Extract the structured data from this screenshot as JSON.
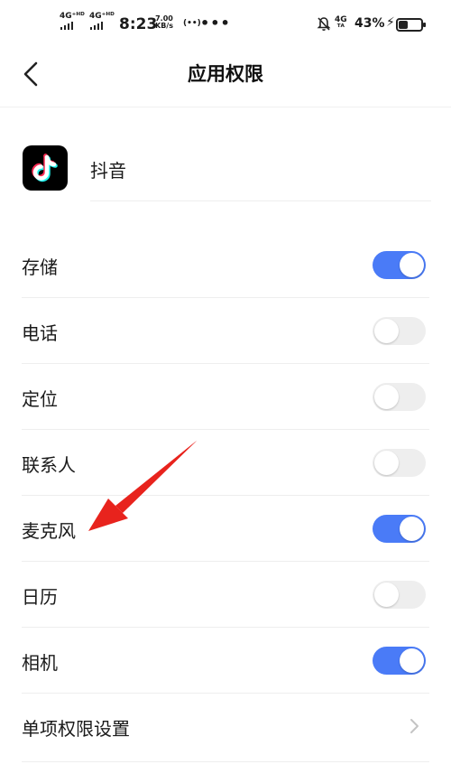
{
  "status_bar": {
    "signal1": "4G⁺ᴴᴰ",
    "signal2": "4G⁺ᴴᴰ",
    "time": "8:23",
    "speed_value": "7.00",
    "speed_unit": "KB/s",
    "hotspot": "(••)",
    "more": "•••",
    "network": "4G",
    "network_sub": "ᵀᴬ",
    "battery_percent": "43%",
    "battery_level": 0.43
  },
  "header": {
    "title": "应用权限"
  },
  "app": {
    "name": "抖音",
    "icon": "douyin-logo"
  },
  "permissions": [
    {
      "label": "存储",
      "enabled": true
    },
    {
      "label": "电话",
      "enabled": false
    },
    {
      "label": "定位",
      "enabled": false
    },
    {
      "label": "联系人",
      "enabled": false
    },
    {
      "label": "麦克风",
      "enabled": true
    },
    {
      "label": "日历",
      "enabled": false
    },
    {
      "label": "相机",
      "enabled": true
    }
  ],
  "individual_settings": {
    "label": "单项权限设置"
  },
  "colors": {
    "toggle_on": "#4a7bf7",
    "toggle_off": "#eeeeee",
    "arrow": "#e8231d"
  }
}
